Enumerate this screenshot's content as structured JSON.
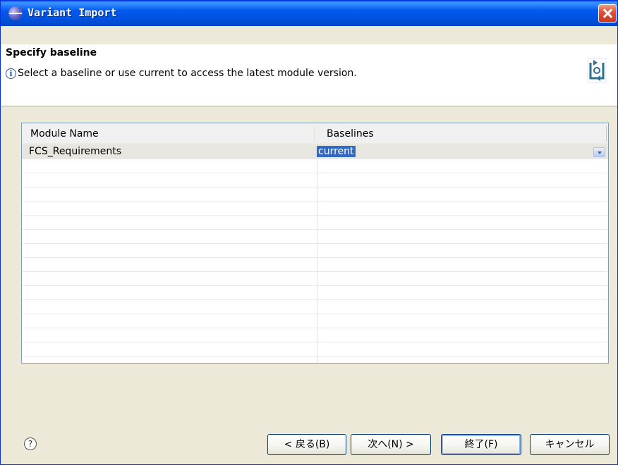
{
  "window": {
    "title": "Variant Import",
    "title_icon": "eclipse-icon",
    "close_icon": "close-icon"
  },
  "header": {
    "title": "Specify baseline",
    "message": "Select a baseline or use current to access the latest module version.",
    "info_icon_glyph": "i",
    "banner_icon": "wizard-banner-icon"
  },
  "table": {
    "columns": [
      "Module Name",
      "Baselines"
    ],
    "rows": [
      {
        "module": "FCS_Requirements",
        "baseline": "current"
      }
    ],
    "selection_color": "#316ac5"
  },
  "footer": {
    "help_glyph": "?",
    "back_label": "< 戻る(B)",
    "next_label": "次へ(N) >",
    "finish_label": "終了(F)",
    "cancel_label": "キャンセル"
  }
}
